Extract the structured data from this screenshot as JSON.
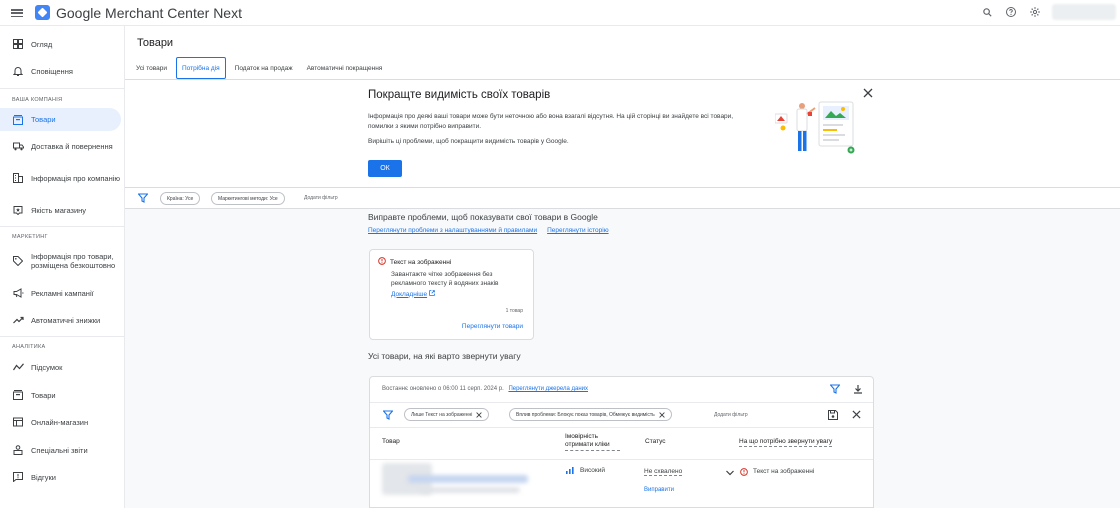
{
  "app": {
    "title": "Google Merchant Center Next"
  },
  "sidebar": {
    "items": [
      {
        "label": "Огляд",
        "icon": "dashboard-icon"
      },
      {
        "label": "Сповіщення",
        "icon": "bell-icon"
      },
      {
        "label": "Товари",
        "icon": "products-icon",
        "active": true
      },
      {
        "label": "Доставка й повернення",
        "icon": "truck-icon"
      },
      {
        "label": "Інформація про компанію",
        "icon": "business-icon"
      },
      {
        "label": "Якість магазину",
        "icon": "store-quality-icon"
      },
      {
        "label": "Інформація про товари, розміщена безкоштовно",
        "icon": "tag-icon"
      },
      {
        "label": "Рекламні кампанії",
        "icon": "megaphone-icon"
      },
      {
        "label": "Автоматичні знижки",
        "icon": "trend-icon"
      },
      {
        "label": "Підсумок",
        "icon": "summary-icon"
      },
      {
        "label": "Товари",
        "icon": "products-icon"
      },
      {
        "label": "Онлайн-магазин",
        "icon": "storefront-icon"
      },
      {
        "label": "Спеціальні звіти",
        "icon": "person-report-icon"
      },
      {
        "label": "Відгуки",
        "icon": "feedback-icon"
      }
    ],
    "sections": {
      "business": "ВАША КОМПАНІЯ",
      "marketing": "МАРКЕТИНГ",
      "analytics": "АНАЛІТИКА"
    }
  },
  "page": {
    "title": "Товари",
    "tabs": [
      "Усі товари",
      "Потрібна дія",
      "Податок на продаж",
      "Автоматичні покращення"
    ]
  },
  "banner": {
    "title": "Покращте видимість своїх товарів",
    "text": "Інформація про деякі ваші товари може бути неточною або вона взагалі відсутня. На цій сторінці ви знайдете всі товари, помилки з якими потрібно виправити.",
    "text2": "Вирішіть ці проблеми, щоб покращити видимість товарів у Google.",
    "ok": "ОК"
  },
  "filters": {
    "chip1": "Країна: Усе",
    "chip2": "Маркетингові методи: Усе",
    "add": "Додати фільтр"
  },
  "issues": {
    "title": "Виправте проблеми, щоб показувати свої товари в Google",
    "link1": "Переглянути проблеми з налаштуваннями й правилами",
    "link2": "Переглянути історію",
    "card": {
      "title": "Текст на зображенні",
      "desc": "Завантажте чітке зображення без рекламного тексту й водяних знаків",
      "more": "Докладніше",
      "count": "1 товар",
      "view": "Переглянути товари"
    }
  },
  "attention": {
    "title": "Усі товари, на які варто звернути увагу",
    "updated": "Востаннє оновлено о 06:00 11 серп. 2024 р.",
    "sources_link": "Переглянути джерела даних",
    "chip1": "Лише Текст на зображенні",
    "chip2": "Вплив проблеми: Блокує показ товарів, Обмежує видимість",
    "add": "Додати фільтр",
    "columns": {
      "product": "Товар",
      "click": "Імовірність отримати кліки",
      "status": "Статус",
      "attention": "На що потрібно звернути увагу"
    },
    "row": {
      "click": "Високий",
      "status": "Не схвалено",
      "fix": "Виправити",
      "issue": "Текст на зображенні"
    }
  },
  "colors": {
    "accent": "#1a73e8",
    "error": "#d93025",
    "active_bg": "#e8f0fe"
  }
}
